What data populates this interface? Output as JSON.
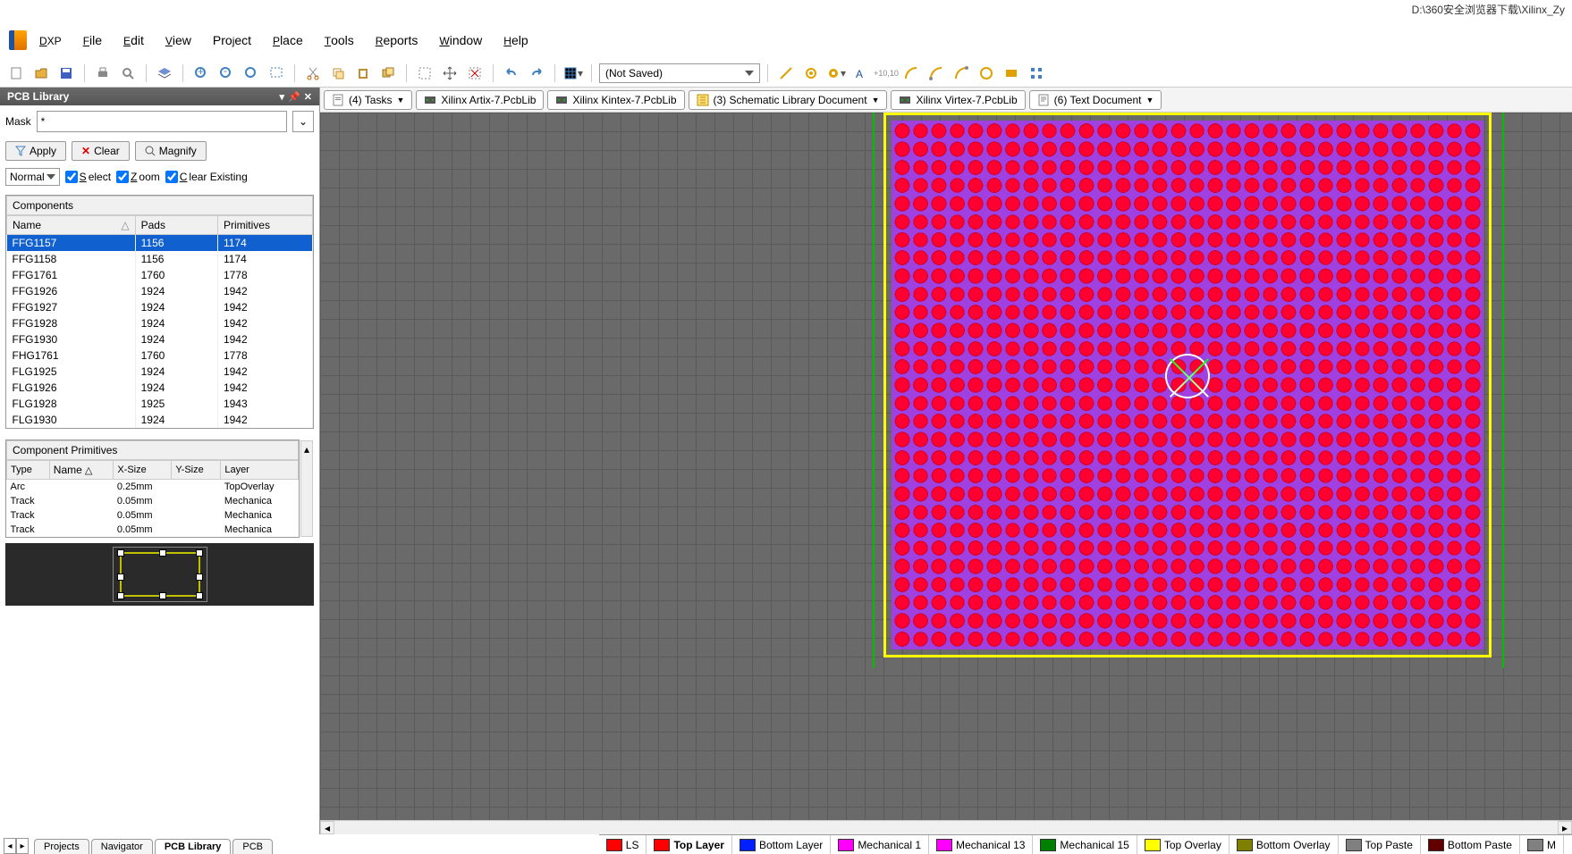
{
  "title_path": "D:\\360安全浏览器下载\\Xilinx_Zy",
  "menu": {
    "dxp": "DXP",
    "file": "File",
    "edit": "Edit",
    "view": "View",
    "project": "Project",
    "place": "Place",
    "tools": "Tools",
    "reports": "Reports",
    "window": "Window",
    "help": "Help"
  },
  "toolbar": {
    "save_combo": "(Not Saved)"
  },
  "panel": {
    "title": "PCB Library",
    "mask_label": "Mask",
    "mask_value": "*",
    "apply": "Apply",
    "clear": "Clear",
    "magnify": "Magnify",
    "mode": "Normal",
    "select": "Select",
    "zoom": "Zoom",
    "clear_existing": "Clear Existing"
  },
  "components": {
    "header": "Components",
    "cols": {
      "name": "Name",
      "pads": "Pads",
      "primitives": "Primitives"
    },
    "rows": [
      {
        "name": "FFG1157",
        "pads": "1156",
        "prims": "1174",
        "sel": true
      },
      {
        "name": "FFG1158",
        "pads": "1156",
        "prims": "1174"
      },
      {
        "name": "FFG1761",
        "pads": "1760",
        "prims": "1778"
      },
      {
        "name": "FFG1926",
        "pads": "1924",
        "prims": "1942"
      },
      {
        "name": "FFG1927",
        "pads": "1924",
        "prims": "1942"
      },
      {
        "name": "FFG1928",
        "pads": "1924",
        "prims": "1942"
      },
      {
        "name": "FFG1930",
        "pads": "1924",
        "prims": "1942"
      },
      {
        "name": "FHG1761",
        "pads": "1760",
        "prims": "1778"
      },
      {
        "name": "FLG1925",
        "pads": "1924",
        "prims": "1942"
      },
      {
        "name": "FLG1926",
        "pads": "1924",
        "prims": "1942"
      },
      {
        "name": "FLG1928",
        "pads": "1925",
        "prims": "1943"
      },
      {
        "name": "FLG1930",
        "pads": "1924",
        "prims": "1942"
      }
    ]
  },
  "primitives": {
    "header": "Component Primitives",
    "cols": {
      "type": "Type",
      "name": "Name",
      "xsize": "X-Size",
      "ysize": "Y-Size",
      "layer": "Layer"
    },
    "rows": [
      {
        "type": "Arc",
        "name": "",
        "xsize": "0.25mm",
        "ysize": "",
        "layer": "TopOverlay"
      },
      {
        "type": "Track",
        "name": "",
        "xsize": "0.05mm",
        "ysize": "",
        "layer": "Mechanica"
      },
      {
        "type": "Track",
        "name": "",
        "xsize": "0.05mm",
        "ysize": "",
        "layer": "Mechanica"
      },
      {
        "type": "Track",
        "name": "",
        "xsize": "0.05mm",
        "ysize": "",
        "layer": "Mechanica"
      }
    ]
  },
  "bottom_tabs": {
    "projects": "Projects",
    "navigator": "Navigator",
    "pcb_library": "PCB Library",
    "pcb": "PCB"
  },
  "doc_tabs": [
    {
      "label": "(4) Tasks",
      "icon": "doc"
    },
    {
      "label": "Xilinx Artix-7.PcbLib",
      "icon": "pcb"
    },
    {
      "label": "Xilinx Kintex-7.PcbLib",
      "icon": "pcb"
    },
    {
      "label": "(3) Schematic Library Document",
      "icon": "sch"
    },
    {
      "label": "Xilinx Virtex-7.PcbLib",
      "icon": "pcb"
    },
    {
      "label": "(6) Text Document",
      "icon": "txt"
    }
  ],
  "layers": [
    {
      "label": "LS",
      "color": "#ff0000",
      "boxed": true
    },
    {
      "label": "Top Layer",
      "color": "#ff0000",
      "active": true
    },
    {
      "label": "Bottom Layer",
      "color": "#0020ff"
    },
    {
      "label": "Mechanical 1",
      "color": "#ff00ff"
    },
    {
      "label": "Mechanical 13",
      "color": "#ff00ff"
    },
    {
      "label": "Mechanical 15",
      "color": "#008000"
    },
    {
      "label": "Top Overlay",
      "color": "#ffff00"
    },
    {
      "label": "Bottom Overlay",
      "color": "#808000"
    },
    {
      "label": "Top Paste",
      "color": "#808080"
    },
    {
      "label": "Bottom Paste",
      "color": "#600000"
    },
    {
      "label": "M",
      "color": "#808080"
    }
  ]
}
